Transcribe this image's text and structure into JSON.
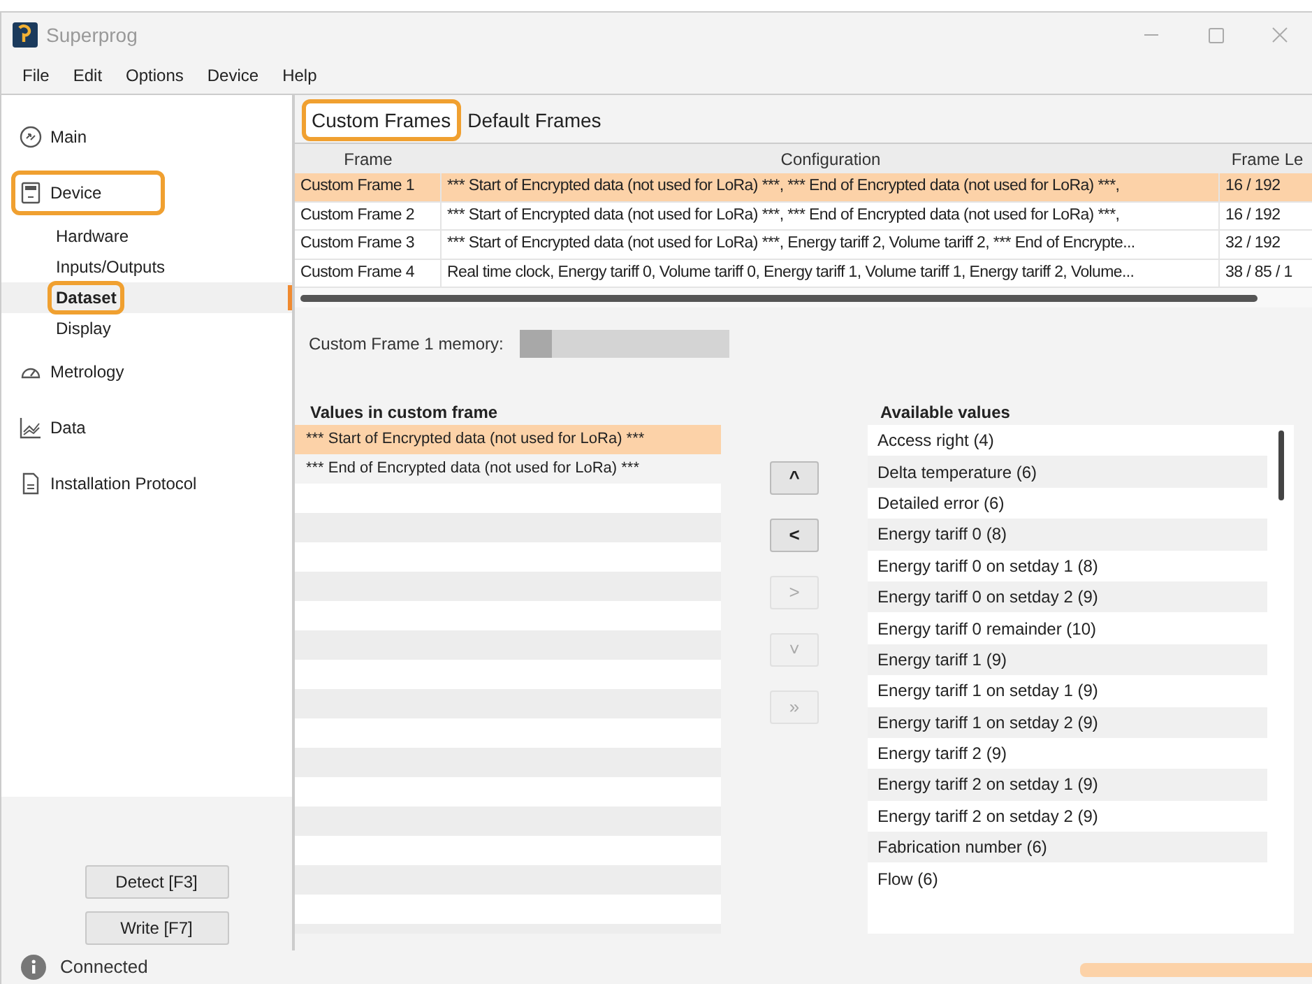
{
  "window": {
    "title": "Superprog"
  },
  "menu": [
    "File",
    "Edit",
    "Options",
    "Device",
    "Help"
  ],
  "sidebar": {
    "items": [
      {
        "label": "Main",
        "kind": "section",
        "selected": false,
        "highlighted": false
      },
      {
        "label": "Device",
        "kind": "section",
        "selected": false,
        "highlighted": true
      },
      {
        "label": "Hardware",
        "kind": "sub",
        "selected": false,
        "highlighted": false
      },
      {
        "label": "Inputs/Outputs",
        "kind": "sub",
        "selected": false,
        "highlighted": false
      },
      {
        "label": "Dataset",
        "kind": "sub",
        "selected": true,
        "highlighted": true
      },
      {
        "label": "Display",
        "kind": "sub",
        "selected": false,
        "highlighted": false
      },
      {
        "label": "Metrology",
        "kind": "section",
        "selected": false,
        "highlighted": false
      },
      {
        "label": "Data",
        "kind": "section",
        "selected": false,
        "highlighted": false
      },
      {
        "label": "Installation Protocol",
        "kind": "section",
        "selected": false,
        "highlighted": false
      }
    ],
    "buttons": [
      "Detect [F3]",
      "Write [F7]"
    ]
  },
  "tabs": [
    {
      "label": "Custom Frames",
      "selected": true,
      "highlighted": true
    },
    {
      "label": "Default Frames",
      "selected": false,
      "highlighted": false
    }
  ],
  "table": {
    "columns": [
      "Frame",
      "Configuration",
      "Frame Le"
    ],
    "rows": [
      {
        "cells": [
          "Custom Frame 1",
          "*** Start of Encrypted data (not used for LoRa) ***, *** End of Encrypted data (not used for LoRa) ***,",
          "16 / 192"
        ],
        "selected": true
      },
      {
        "cells": [
          "Custom Frame 2",
          "*** Start of Encrypted data (not used for LoRa) ***, *** End of Encrypted data (not used for LoRa) ***,",
          "16 / 192"
        ],
        "selected": false
      },
      {
        "cells": [
          "Custom Frame 3",
          "*** Start of Encrypted data (not used for LoRa) ***, Energy tariff 2, Volume tariff 2, *** End of Encrypte...",
          "32 / 192"
        ],
        "selected": false
      },
      {
        "cells": [
          "Custom Frame 4",
          "Real time clock, Energy tariff 0, Volume tariff 0, Energy tariff 1, Volume tariff 1, Energy tariff 2, Volume...",
          "38 / 85 / 1"
        ],
        "selected": false
      }
    ]
  },
  "memory": {
    "label": "Custom Frame 1 memory:",
    "level": 0.15
  },
  "values_in_frame": {
    "title": "Values in custom frame",
    "items": [
      {
        "label": "*** Start of Encrypted data (not used for LoRa) ***",
        "selected": true
      },
      {
        "label": "*** End of Encrypted data (not used for LoRa) ***",
        "selected": false
      }
    ]
  },
  "move_buttons": [
    {
      "label": "^",
      "disabled": false
    },
    {
      "label": "<",
      "disabled": false
    },
    {
      "label": ">",
      "disabled": true
    },
    {
      "label": "˅",
      "disabled": true
    },
    {
      "label": "»",
      "disabled": true
    }
  ],
  "available_values": {
    "title": "Available values",
    "items": [
      "Access right (4)",
      "Delta temperature (6)",
      "Detailed error (6)",
      "Energy tariff 0 (8)",
      "Energy tariff 0 on setday 1 (8)",
      "Energy tariff 0 on setday 2 (9)",
      "Energy tariff 0 remainder (10)",
      "Energy tariff 1 (9)",
      "Energy tariff 1 on setday 1 (9)",
      "Energy tariff 1 on setday 2 (9)",
      "Energy tariff 2 (9)",
      "Energy tariff 2 on setday 1 (9)",
      "Energy tariff 2 on setday 2 (9)",
      "Fabrication number (6)",
      "Flow (6)"
    ]
  },
  "status_bar": {
    "text": "Connected",
    "progress": {
      "level": 1
    }
  }
}
